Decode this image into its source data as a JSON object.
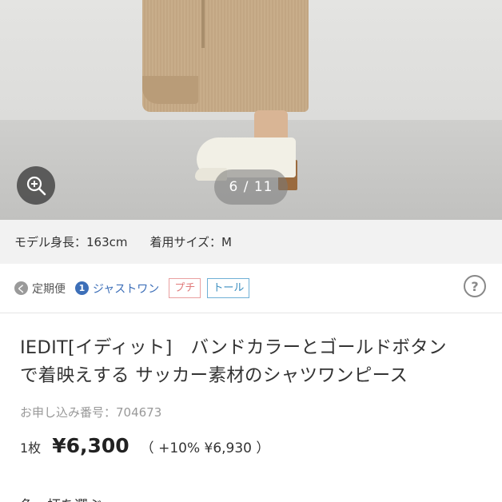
{
  "gallery": {
    "counter": "6 / 11",
    "zoom_icon": "zoom-in-icon"
  },
  "model_info": {
    "height": "モデル身長：163cm",
    "size": "着用サイズ：M"
  },
  "shipping": {
    "teiki_icon_glyph": "く",
    "teiki_label": "定期便",
    "just_icon_glyph": "1",
    "just_label": "ジャストワン",
    "tag_petite": "プチ",
    "tag_tall": "トール",
    "help_glyph": "?"
  },
  "product": {
    "title_line1": "IEDIT[イディット]　バンドカラーとゴールドボタン",
    "title_line2": "で着映えする サッカー素材のシャツワンピース",
    "order_number": "お申し込み番号：704673",
    "quantity": "1枚",
    "price": "¥6,300",
    "tax_note": "（ +10%  ¥6,930 ）",
    "select_color_label": "色・柄を選ぶ"
  },
  "colors": {
    "brand_blue": "#3d6fb8",
    "petite_pink": "#e07a7a",
    "tall_blue": "#3d8fc0"
  }
}
